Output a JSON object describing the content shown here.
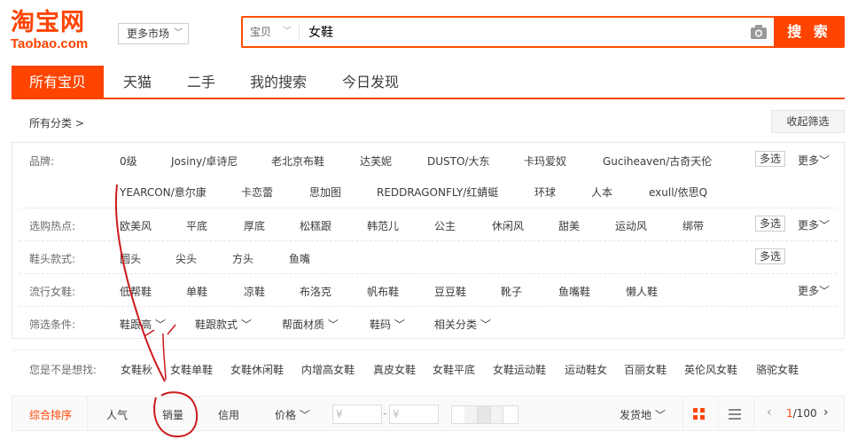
{
  "header": {
    "logo_cn": "淘宝网",
    "logo_en": "Taobao.com",
    "market_label": "更多市场",
    "search_scope": "宝贝",
    "search_query": "女鞋",
    "search_button": "搜 索"
  },
  "tabs": [
    "所有宝贝",
    "天猫",
    "二手",
    "我的搜索",
    "今日发现"
  ],
  "category": {
    "all_label": "所有分类 >",
    "fold_label": "收起筛选"
  },
  "filters": {
    "brand": {
      "label": "品牌:",
      "items_row1": [
        "0级",
        "Josiny/卓诗尼",
        "老北京布鞋",
        "达芙妮",
        "DUSTO/大东",
        "卡玛爱奴",
        "Guciheaven/古奇天伦"
      ],
      "items_row2": [
        "YEARCON/意尔康",
        "卡恋蕾",
        "思加图",
        "REDDRAGONFLY/红蜻蜓",
        "环球",
        "人本",
        "exull/依思Q"
      ]
    },
    "hot": {
      "label": "选购热点:",
      "items": [
        "欧美风",
        "平底",
        "厚底",
        "松糕跟",
        "韩范儿",
        "公主",
        "休闲风",
        "甜美",
        "运动风",
        "绑带"
      ]
    },
    "toe": {
      "label": "鞋头款式:",
      "items": [
        "圆头",
        "尖头",
        "方头",
        "鱼嘴"
      ]
    },
    "popular": {
      "label": "流行女鞋:",
      "items": [
        "低帮鞋",
        "单鞋",
        "凉鞋",
        "布洛克",
        "帆布鞋",
        "豆豆鞋",
        "靴子",
        "鱼嘴鞋",
        "懒人鞋"
      ]
    },
    "conditions": {
      "label": "筛选条件:",
      "items": [
        "鞋跟高",
        "鞋跟款式",
        "帮面材质",
        "鞋码",
        "相关分类"
      ]
    },
    "multi_label": "多选",
    "more_label": "更多"
  },
  "suggest": {
    "label": "您是不是想找:",
    "items": [
      "女鞋秋",
      "女鞋单鞋",
      "女鞋休闲鞋",
      "内增高女鞋",
      "真皮女鞋",
      "女鞋平底",
      "女鞋运动鞋",
      "运动鞋女",
      "百丽女鞋",
      "英伦风女鞋",
      "骆驼女鞋"
    ]
  },
  "sortbar": {
    "items": [
      "综合排序",
      "人气",
      "销量",
      "信用",
      "价格"
    ],
    "price_from": "¥",
    "price_to": "¥",
    "price_dash": "-",
    "ship_from": "发货地",
    "page_current": "1",
    "page_total": "/100"
  },
  "colors": {
    "accent": "#ff4400",
    "annotation": "#cc1a1a"
  }
}
